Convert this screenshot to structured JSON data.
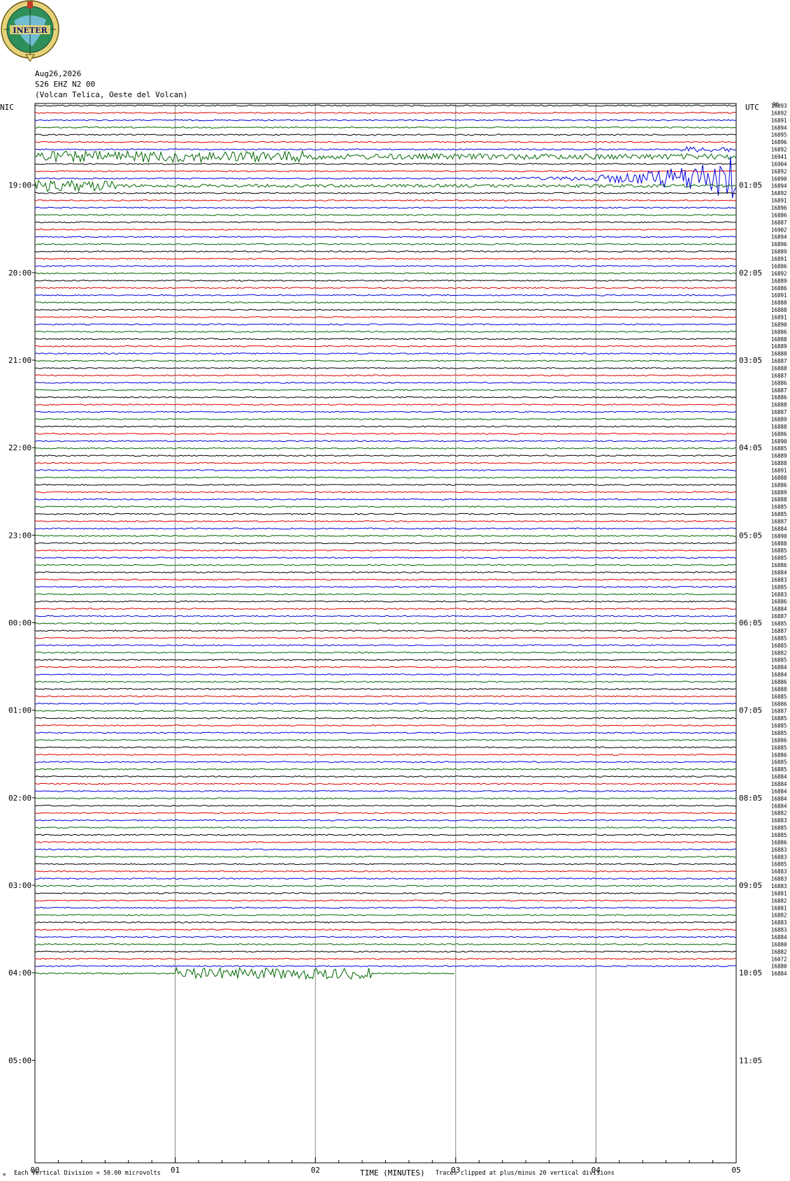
{
  "header": {
    "date": "Aug26,2026",
    "station": "S26 EHZ N2 00",
    "location": "(Volcan Telica, Oeste del Volcan)",
    "logo_text": "INETER"
  },
  "chart_data": {
    "type": "helicorder",
    "left_timezone": "NIC",
    "right_timezone": "UTC",
    "left_hour_labels": [
      "19:00",
      "20:00",
      "21:00",
      "22:00",
      "23:00",
      "00:00",
      "01:00",
      "02:00",
      "03:00",
      "04:00",
      "05:00"
    ],
    "right_hour_labels": [
      "01:05",
      "02:05",
      "03:05",
      "04:05",
      "05:05",
      "06:05",
      "07:05",
      "08:05",
      "09:05",
      "10:05",
      "11:05"
    ],
    "x_ticks": [
      "00",
      "01",
      "02",
      "03",
      "04",
      "05"
    ],
    "xlabel": "TIME (MINUTES)",
    "xlim": [
      0,
      5
    ],
    "lines_per_hour": 12,
    "trace_colors": [
      "#000000",
      "#dd0000",
      "#0000dd",
      "#006600"
    ],
    "grid": "vertical lines at each minute",
    "right_count_header": "96",
    "right_counts": [
      "16893",
      "16892",
      "16891",
      "16894",
      "16895",
      "16896",
      "16892",
      "16941",
      "16904",
      "16892",
      "16890",
      "16894",
      "16892",
      "16891",
      "16896",
      "16886",
      "16887",
      "16902",
      "16894",
      "16896",
      "16889",
      "16891",
      "16886",
      "16892",
      "16889",
      "16886",
      "16891",
      "16888",
      "16888",
      "16891",
      "16890",
      "16886",
      "16888",
      "16889",
      "16888",
      "16887",
      "16888",
      "16887",
      "16886",
      "16887",
      "16886",
      "16888",
      "16887",
      "16889",
      "16888",
      "16886",
      "16890",
      "16885",
      "16889",
      "16888",
      "16891",
      "16888",
      "16886",
      "16889",
      "16888",
      "16885",
      "16885",
      "16887",
      "16884",
      "16890",
      "16888",
      "16885",
      "16885",
      "16886",
      "16884",
      "16883",
      "16885",
      "16883",
      "16886",
      "16884",
      "16887",
      "16885",
      "16887",
      "16885",
      "16885",
      "16882",
      "16885",
      "16884",
      "16884",
      "16886",
      "16888",
      "16885",
      "16886",
      "16887",
      "16885",
      "16885",
      "16885",
      "16886",
      "16885",
      "16886",
      "16885",
      "16885",
      "16884",
      "16884",
      "16884",
      "16884",
      "16884",
      "16882",
      "16883",
      "16885",
      "16885",
      "16886",
      "16883",
      "16883",
      "16885",
      "16883",
      "16883",
      "16883",
      "16881",
      "16882",
      "16881",
      "16882",
      "16883",
      "16883",
      "16884",
      "16880",
      "16882",
      "16072",
      "16880",
      "16884"
    ],
    "events": [
      {
        "line": 7,
        "from_min": 0.0,
        "to_min": 2.0,
        "amplitude": "large",
        "color": "#006600"
      },
      {
        "line": 7,
        "from_min": 2.0,
        "to_min": 5.0,
        "amplitude": "moderate",
        "color": "#006600"
      },
      {
        "line": 6,
        "from_min": 4.6,
        "to_min": 5.0,
        "amplitude": "moderate",
        "color": "#0000dd"
      },
      {
        "line": 10,
        "from_min": 3.2,
        "to_min": 5.0,
        "amplitude": "very large",
        "color": "#0000dd"
      },
      {
        "line": 11,
        "from_min": 0.0,
        "to_min": 0.6,
        "amplitude": "large",
        "color": "#006600"
      },
      {
        "line": 11,
        "from_min": 0.6,
        "to_min": 5.0,
        "amplitude": "small",
        "color": "#006600"
      },
      {
        "line": 119,
        "from_min": 1.0,
        "to_min": 2.4,
        "amplitude": "large",
        "color": "#006600"
      }
    ],
    "last_line_end_min": 3.0
  },
  "footer": {
    "vertical_division": "Each Vertical Division =    50.00 microvolts",
    "xlabel": "TIME (MINUTES)",
    "clip_note": "Traces clipped at plus/minus 20 vertical divisions"
  }
}
